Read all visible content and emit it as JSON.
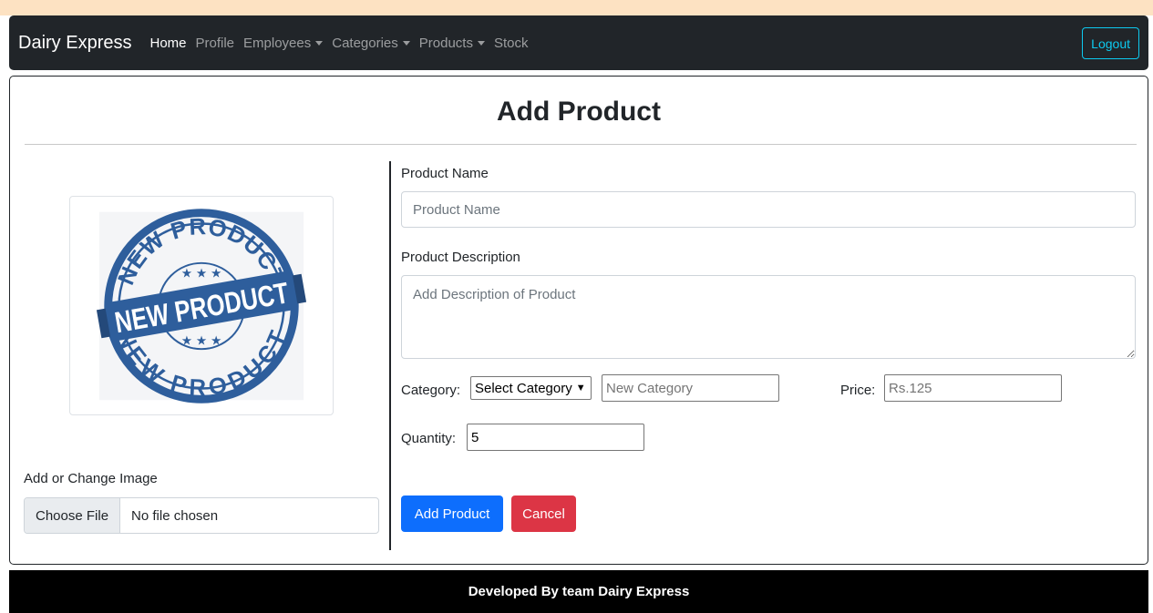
{
  "navbar": {
    "brand": "Dairy Express",
    "links": [
      {
        "label": "Home",
        "active": true,
        "dropdown": false
      },
      {
        "label": "Profile",
        "active": false,
        "dropdown": false
      },
      {
        "label": "Employees",
        "active": false,
        "dropdown": true
      },
      {
        "label": "Categories",
        "active": false,
        "dropdown": true
      },
      {
        "label": "Products",
        "active": false,
        "dropdown": true
      },
      {
        "label": "Stock",
        "active": false,
        "dropdown": false
      }
    ],
    "logout_label": "Logout"
  },
  "page": {
    "title": "Add Product"
  },
  "image_panel": {
    "badge_text_top": "NEW PRODUCT",
    "badge_text_center": "NEW PRODUCT",
    "badge_text_bottom": "NEW PRODUCT",
    "badge_color": "#2e5e9c",
    "change_label": "Add or Change Image",
    "choose_file_label": "Choose File",
    "file_status": "No file chosen"
  },
  "form": {
    "name_label": "Product Name",
    "name_placeholder": "Product Name",
    "description_label": "Product Description",
    "description_placeholder": "Add Description of Product",
    "category_label": "Category:",
    "category_selected": "Select Category",
    "new_category_placeholder": "New Category",
    "price_label": "Price:",
    "price_placeholder": "Rs.125",
    "quantity_label": "Quantity:",
    "quantity_value": "5",
    "add_button": "Add Product",
    "cancel_button": "Cancel"
  },
  "footer": {
    "text": "Developed By team Dairy Express"
  },
  "colors": {
    "navbar_bg": "#212529",
    "logout_accent": "#0dcaf0",
    "primary": "#0d6efd",
    "danger": "#dc3545",
    "footer_bg": "#000000",
    "top_strip": "#fde2c2"
  }
}
